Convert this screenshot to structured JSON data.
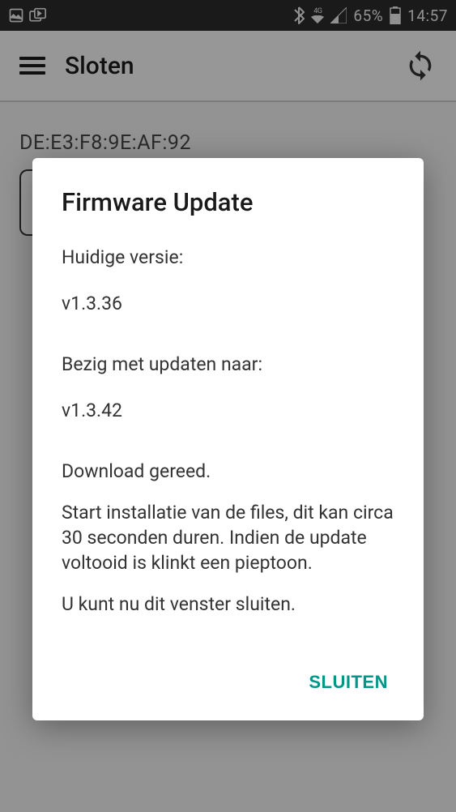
{
  "status_bar": {
    "network_label_top": "4G",
    "network_label_bottom": "⚡",
    "battery_percent": "65%",
    "time": "14:57"
  },
  "app_bar": {
    "title": "Sloten"
  },
  "content": {
    "mac_address": "DE:E3:F8:9E:AF:92"
  },
  "dialog": {
    "title": "Firmware Update",
    "current_version_label": "Huidige versie:",
    "current_version": "v1.3.36",
    "target_version_label": "Bezig met updaten naar:",
    "target_version": "v1.3.42",
    "download_status": "Download gereed.",
    "install_message": "Start installatie van de files, dit kan circa 30 seconden duren. Indien de update voltooid is klinkt een pieptoon.",
    "close_hint": "U kunt nu dit venster sluiten.",
    "close_button": "SLUITEN"
  }
}
